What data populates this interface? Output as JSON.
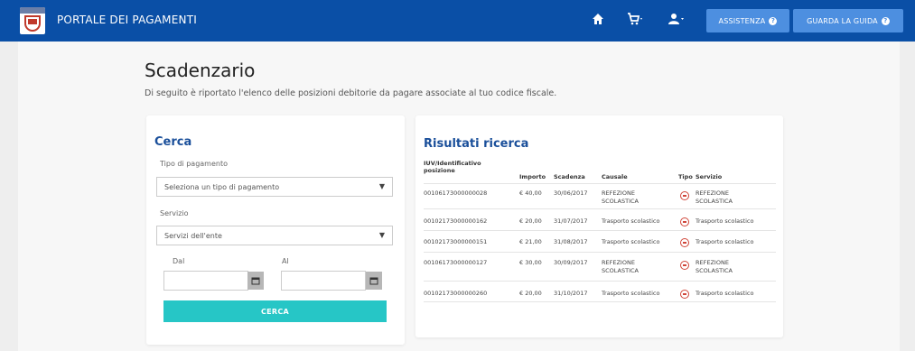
{
  "topbar": {
    "brand": "PORTALE DEI PAGAMENTI",
    "assist_label": "ASSISTENZA",
    "guide_label": "GUARDA LA GUIDA",
    "icons": [
      "home-icon",
      "cart-icon",
      "user-icon",
      "question-icon"
    ]
  },
  "page": {
    "title": "Scadenzario",
    "subtitle": "Di seguito è riportato l'elenco delle posizioni debitorie da pagare associate al tuo codice fiscale."
  },
  "search": {
    "title": "Cerca",
    "payment_type_label": "Tipo di pagamento",
    "payment_type_value": "Seleziona un tipo di pagamento",
    "service_label": "Servizio",
    "service_value": "Servizi dell'ente",
    "from_label": "Dal",
    "to_label": "Al",
    "button_label": "CERCA"
  },
  "results": {
    "title": "Risultati ricerca",
    "columns": {
      "id": "IUV/Identificativo posizione",
      "amount": "Importo",
      "due": "Scadenza",
      "reason": "Causale",
      "type": "Tipo",
      "service": "Servizio"
    },
    "rows": [
      {
        "id": "00106173000000028",
        "amount": "€ 40,00",
        "due": "30/06/2017",
        "reason": "REFEZIONE SCOLASTICA",
        "service": "REFEZIONE SCOLASTICA"
      },
      {
        "id": "00102173000000162",
        "amount": "€ 20,00",
        "due": "31/07/2017",
        "reason": "Trasporto scolastico",
        "service": "Trasporto scolastico"
      },
      {
        "id": "00102173000000151",
        "amount": "€ 21,00",
        "due": "31/08/2017",
        "reason": "Trasporto scolastico",
        "service": "Trasporto scolastico"
      },
      {
        "id": "00106173000000127",
        "amount": "€ 30,00",
        "due": "30/09/2017",
        "reason": "REFEZIONE SCOLASTICA",
        "service": "REFEZIONE SCOLASTICA"
      },
      {
        "id": "00102173000000260",
        "amount": "€ 20,00",
        "due": "31/10/2017",
        "reason": "Trasporto scolastico",
        "service": "Trasporto scolastico"
      }
    ]
  },
  "colors": {
    "topbar": "#0a4fa6",
    "accent_button": "#26c6c6",
    "title_blue": "#1a4f9a"
  }
}
